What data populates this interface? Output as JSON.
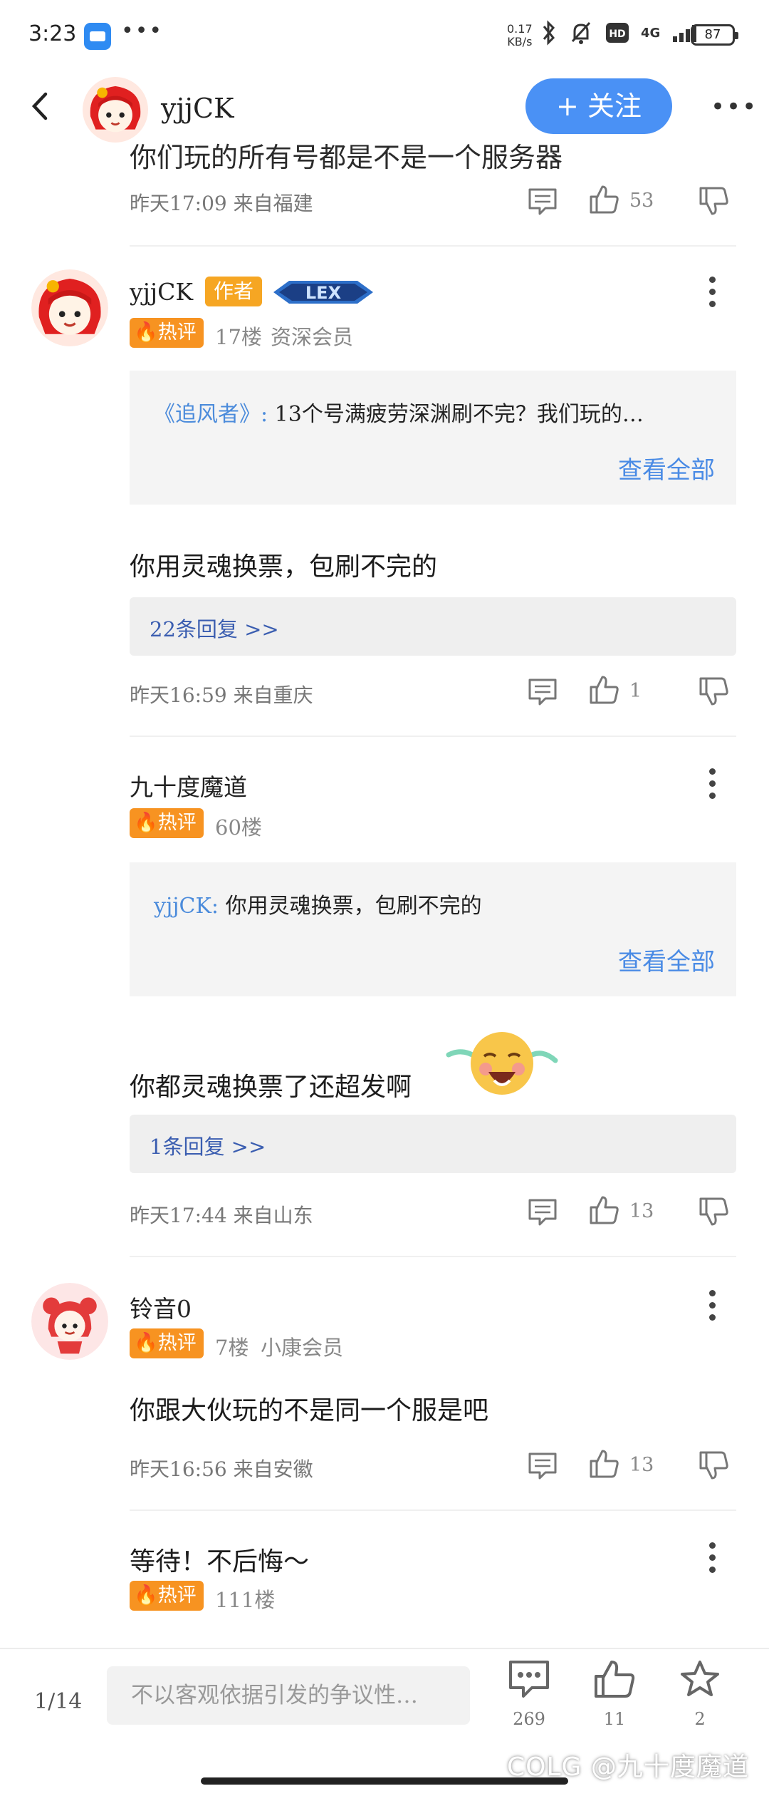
{
  "status_bar": {
    "time": "3:23",
    "net_speed_value": "0.17",
    "net_speed_unit": "KB/s",
    "network": "4G",
    "battery": "87"
  },
  "header": {
    "username": "yjjCK",
    "follow_label": "+ 关注"
  },
  "comments": [
    {
      "cut_text": "你们玩的所有号都是不是一个服务器",
      "meta": "昨天17:09 来自福建",
      "likes": "53"
    },
    {
      "username": "yjjCK",
      "author_tag": "作者",
      "level_badge": "LEX",
      "hot_label": "热评",
      "floor": "17楼",
      "member": "资深会员",
      "quote_user": "《追风者》:",
      "quote_text": "13个号满疲劳深渊刷不完？我们玩的…",
      "view_all": "查看全部",
      "content": "你用灵魂换票，包刷不完的",
      "replies": "22条回复 >>",
      "meta": "昨天16:59 来自重庆",
      "likes": "1"
    },
    {
      "username": "九十度魔道",
      "hot_label": "热评",
      "floor": "60楼",
      "quote_user": "yjjCK:",
      "quote_text": "你用灵魂换票，包刷不完的",
      "view_all": "查看全部",
      "content": "你都灵魂换票了还超发啊",
      "replies": "1条回复 >>",
      "meta": "昨天17:44 来自山东",
      "likes": "13"
    },
    {
      "username": "铃音0",
      "hot_label": "热评",
      "floor": "7楼",
      "member": "小康会员",
      "content": "你跟大伙玩的不是同一个服是吧",
      "meta": "昨天16:56 来自安徽",
      "likes": "13"
    },
    {
      "content": "等待！不后悔～",
      "hot_label": "热评",
      "floor": "111楼"
    }
  ],
  "bottom_bar": {
    "page_indicator": "1/14",
    "input_placeholder": "不以客观依据引发的争议性…",
    "comment_count": "269",
    "like_count": "11",
    "favorite_count": "2"
  },
  "watermark": "COLG @九十度魔道",
  "colors": {
    "accent": "#4a91f5",
    "hot_tag": "#f79321",
    "author_tag": "#f6a623",
    "link": "#4a8be5"
  }
}
